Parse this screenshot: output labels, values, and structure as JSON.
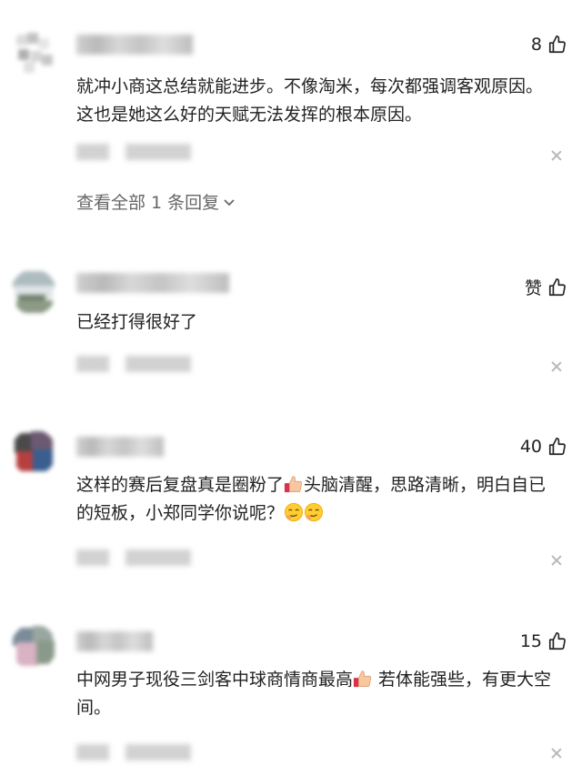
{
  "comments": [
    {
      "likes": "8",
      "text": "就冲小商这总结就能进步。不像淘米，每次都强调客观原因。这也是她这么好的天赋无法发挥的根本原因。",
      "view_replies": "查看全部 1 条回复",
      "colors": [
        "#d9d9d9",
        "#c5c5c5",
        "#e3e3e3",
        "#b5b5b5"
      ]
    },
    {
      "likes": "赞",
      "text": "已经打得很好了",
      "colors": [
        "#b8c4c2",
        "#d8dde0",
        "#7b8a78",
        "#5d6c5a"
      ]
    },
    {
      "likes": "40",
      "text_parts": [
        "这样的赛后复盘真是圈粉了",
        "头脑清醒，思路清晰，明白自已的短板，小郑同学你说呢？"
      ],
      "emoji_names": [
        "thumbs-up-emoji",
        "smirk-emoji"
      ],
      "colors": [
        "#3a3a3a",
        "#b33a3a",
        "#5b4e6a",
        "#3d6ea8"
      ]
    },
    {
      "likes": "15",
      "text_parts": [
        "中网男子现役三剑客中球商情商最高",
        " 若体能强些，有更大空间。"
      ],
      "emoji_names": [
        "thumbs-up-emoji"
      ],
      "colors": [
        "#6d7f8c",
        "#b7a1b3",
        "#e6c5d3",
        "#8a9a8a"
      ]
    }
  ],
  "icons": {
    "like": "thumbs-up-outline-icon",
    "close": "close-icon",
    "chevron": "chevron-down-icon"
  }
}
